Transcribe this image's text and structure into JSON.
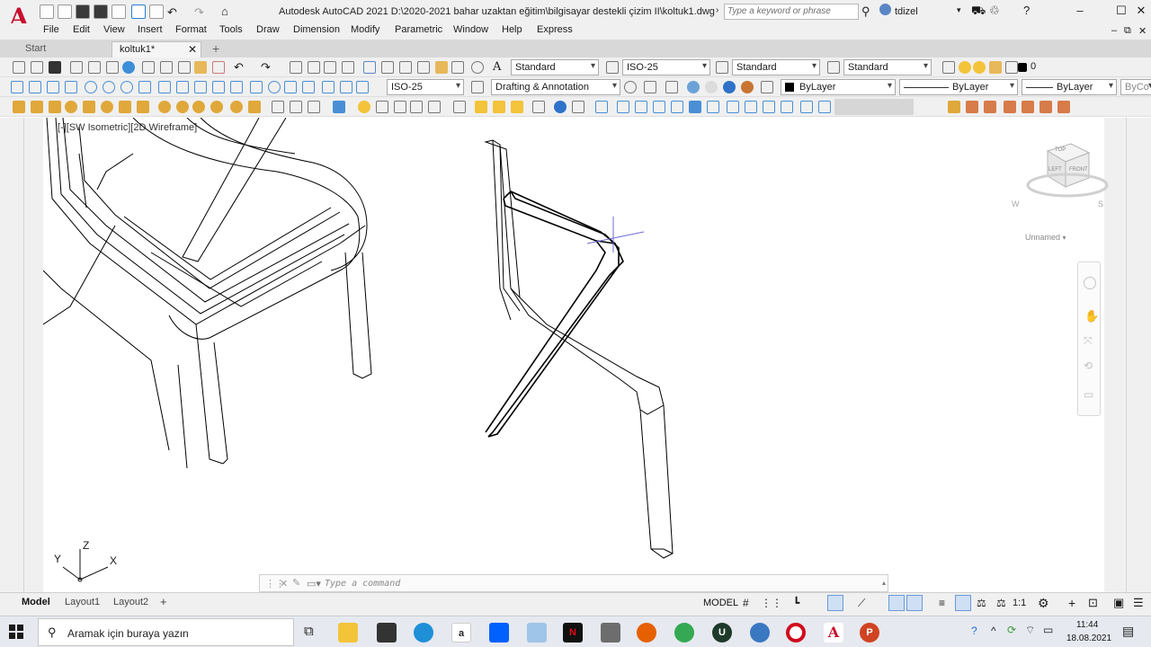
{
  "titlebar": {
    "logo": "A",
    "app_title": "Autodesk AutoCAD 2021    D:\\2020-2021 bahar uzaktan eğitim\\bilgisayar destekli çizim II\\koltuk1.dwg",
    "search_placeholder": "Type a keyword or phrase",
    "user": "tdizel"
  },
  "menu": [
    "File",
    "Edit",
    "View",
    "Insert",
    "Format",
    "Tools",
    "Draw",
    "Dimension",
    "Modify",
    "Parametric",
    "Window",
    "Help",
    "Express"
  ],
  "tabs": {
    "start": "Start",
    "active": "koltuk1*"
  },
  "styles_toolbar": {
    "text_style": "Standard",
    "dim_style": "ISO-25",
    "table_style": "Standard",
    "mleader_style": "Standard",
    "layer": "0"
  },
  "properties_toolbar": {
    "dim_style": "ISO-25",
    "workspace": "Drafting & Annotation",
    "color": "ByLayer",
    "linetype": "ByLayer",
    "lineweight": "ByLayer",
    "plotstyle": "ByCo"
  },
  "viewport": {
    "label": "[-][SW Isometric][2D Wireframe]",
    "viewcube_name": "Unnamed",
    "viewcube_faces": [
      "TOP",
      "LEFT",
      "FRONT"
    ],
    "compass": [
      "W",
      "S"
    ],
    "ucs_axes": [
      "Z",
      "Y",
      "X"
    ]
  },
  "command": {
    "placeholder": "Type a command"
  },
  "status": {
    "layout_tabs": [
      "Model",
      "Layout1",
      "Layout2"
    ],
    "model": "MODEL",
    "scale": "1:1"
  },
  "taskbar": {
    "search_placeholder": "Aramak için buraya yazın",
    "time": "11:44",
    "date": "18.08.2021"
  },
  "colors": {
    "autocad_red": "#c8102e",
    "toolbar_bg": "#f0f0f0",
    "canvas_bg": "#ffffff",
    "taskbar_bg": "#e6e9ef"
  }
}
